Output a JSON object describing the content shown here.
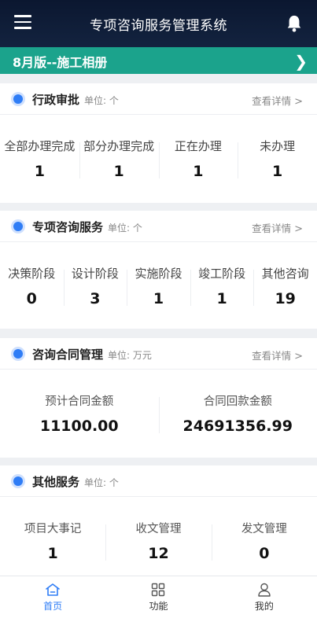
{
  "header": {
    "title": "专项咨询服务管理系统"
  },
  "banner": {
    "text": "8月版--施工相册"
  },
  "sections": [
    {
      "title": "行政审批",
      "unit": "单位: 个",
      "detail": "查看详情",
      "stats": [
        {
          "label": "全部办理完成",
          "value": "1"
        },
        {
          "label": "部分办理完成",
          "value": "1"
        },
        {
          "label": "正在办理",
          "value": "1"
        },
        {
          "label": "未办理",
          "value": "1"
        }
      ]
    },
    {
      "title": "专项咨询服务",
      "unit": "单位: 个",
      "detail": "查看详情",
      "stats": [
        {
          "label": "决策阶段",
          "value": "0"
        },
        {
          "label": "设计阶段",
          "value": "3"
        },
        {
          "label": "实施阶段",
          "value": "1"
        },
        {
          "label": "竣工阶段",
          "value": "1"
        },
        {
          "label": "其他咨询",
          "value": "19"
        }
      ]
    },
    {
      "title": "咨询合同管理",
      "unit": "单位: 万元",
      "detail": "查看详情",
      "stats": [
        {
          "label": "预计合同金额",
          "value": "11100.00"
        },
        {
          "label": "合同回款金额",
          "value": "24691356.99"
        }
      ]
    },
    {
      "title": "其他服务",
      "unit": "单位: 个",
      "stats": [
        {
          "label": "项目大事记",
          "value": "1"
        },
        {
          "label": "收文管理",
          "value": "12"
        },
        {
          "label": "发文管理",
          "value": "0"
        }
      ]
    }
  ],
  "tabs": [
    {
      "label": "首页",
      "icon": "home-icon",
      "active": true
    },
    {
      "label": "功能",
      "icon": "grid-icon",
      "active": false
    },
    {
      "label": "我的",
      "icon": "user-icon",
      "active": false
    }
  ],
  "colors": {
    "accent": "#2f7df6",
    "banner": "#1ba38c",
    "header": "#0b1730"
  }
}
